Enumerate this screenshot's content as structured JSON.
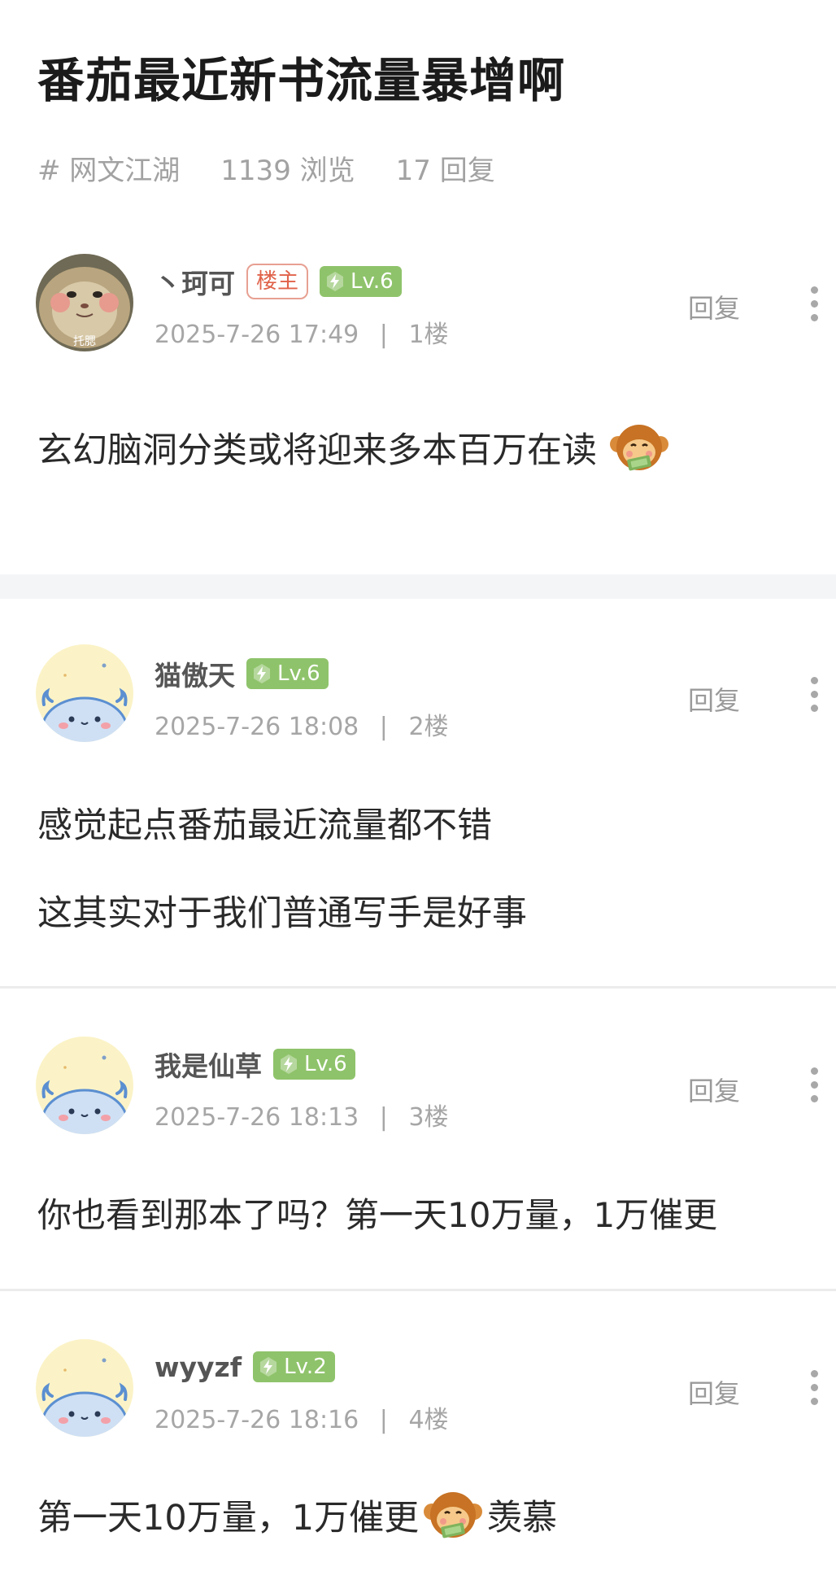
{
  "thread": {
    "title": "番茄最近新书流量暴增啊",
    "tag": "# 网文江湖",
    "views": "1139 浏览",
    "replies": "17 回复"
  },
  "posts": [
    {
      "username": "丶珂可",
      "op_badge": "楼主",
      "level": "Lv.6",
      "time": "2025-7-26 17:49",
      "floor": "1楼",
      "reply_label": "回复",
      "avatar": "hamster-photo-avatar",
      "avatar_text": "托腮",
      "content_lines": [
        "玄幻脑洞分类或将迎来多本百万在读"
      ],
      "emoji": "monkey-money-emoji"
    },
    {
      "username": "猫傲天",
      "level": "Lv.6",
      "time": "2025-7-26 18:08",
      "floor": "2楼",
      "reply_label": "回复",
      "avatar": "blue-dragon-avatar",
      "content_lines": [
        "感觉起点番茄最近流量都不错",
        "这其实对于我们普通写手是好事"
      ]
    },
    {
      "username": "我是仙草",
      "level": "Lv.6",
      "time": "2025-7-26 18:13",
      "floor": "3楼",
      "reply_label": "回复",
      "avatar": "blue-dragon-avatar",
      "content_lines": [
        "你也看到那本了吗？第一天10万量，1万催更"
      ]
    },
    {
      "username": "wyyzf",
      "level": "Lv.2",
      "time": "2025-7-26 18:16",
      "floor": "4楼",
      "reply_label": "回复",
      "avatar": "blue-dragon-avatar",
      "content_before_emoji": "第一天10万量，1万催更",
      "content_after_emoji": "羡慕",
      "emoji": "monkey-money-emoji"
    }
  ],
  "separator": "|",
  "colors": {
    "level_badge": "#8fc36b",
    "op_badge": "#e0624a",
    "meta_text": "#a2a2a2"
  }
}
